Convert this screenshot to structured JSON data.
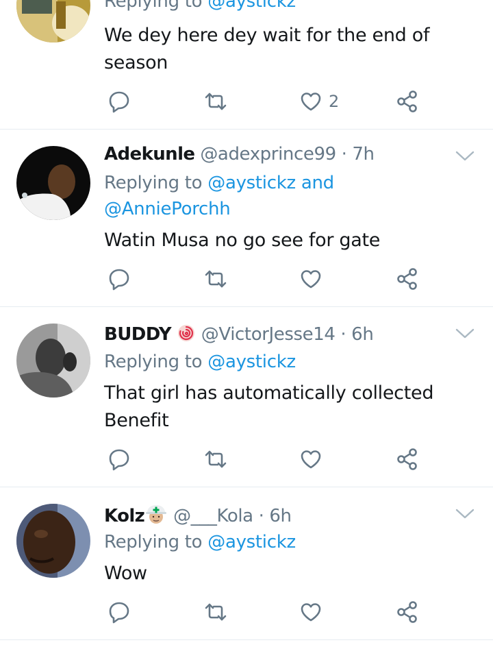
{
  "colors": {
    "mention": "#1b95e0",
    "muted": "#657786",
    "text": "#14171a",
    "divider": "#e6ecf0"
  },
  "tweets": [
    {
      "reply_prefix": "Replying to ",
      "mentions": [
        "@aystickz"
      ],
      "text_lines": [
        "We dey here dey wait for the end of",
        "season"
      ],
      "like_count": "2",
      "icons": [
        "reply-icon",
        "retweet-icon",
        "heart-icon",
        "share-icon"
      ]
    },
    {
      "name": "Adekunle",
      "handle": "@adexprince99",
      "separator": "·",
      "time": "7h",
      "reply_prefix": "Replying to ",
      "mentions": [
        "@aystickz",
        "@AnniePorchh"
      ],
      "joiner": "and",
      "text_lines": [
        "Watin Musa no go see for gate"
      ],
      "icons": [
        "reply-icon",
        "retweet-icon",
        "heart-icon",
        "share-icon",
        "chevron-down-icon"
      ]
    },
    {
      "name": "BUDDY",
      "name_emoji": "cyclone-emoji",
      "handle": "@VictorJesse14",
      "separator": "·",
      "time": "6h",
      "reply_prefix": "Replying to ",
      "mentions": [
        "@aystickz"
      ],
      "text_lines": [
        "That girl has automatically collected",
        "Benefit"
      ],
      "icons": [
        "reply-icon",
        "retweet-icon",
        "heart-icon",
        "share-icon",
        "chevron-down-icon"
      ]
    },
    {
      "name": "Kolz",
      "name_emoji": "rescue-worker-helmet-emoji",
      "handle": "@___Kola",
      "separator": "·",
      "time": "6h",
      "reply_prefix": "Replying to ",
      "mentions": [
        "@aystickz"
      ],
      "text_lines": [
        "Wow"
      ],
      "icons": [
        "reply-icon",
        "retweet-icon",
        "heart-icon",
        "share-icon",
        "chevron-down-icon"
      ]
    }
  ]
}
